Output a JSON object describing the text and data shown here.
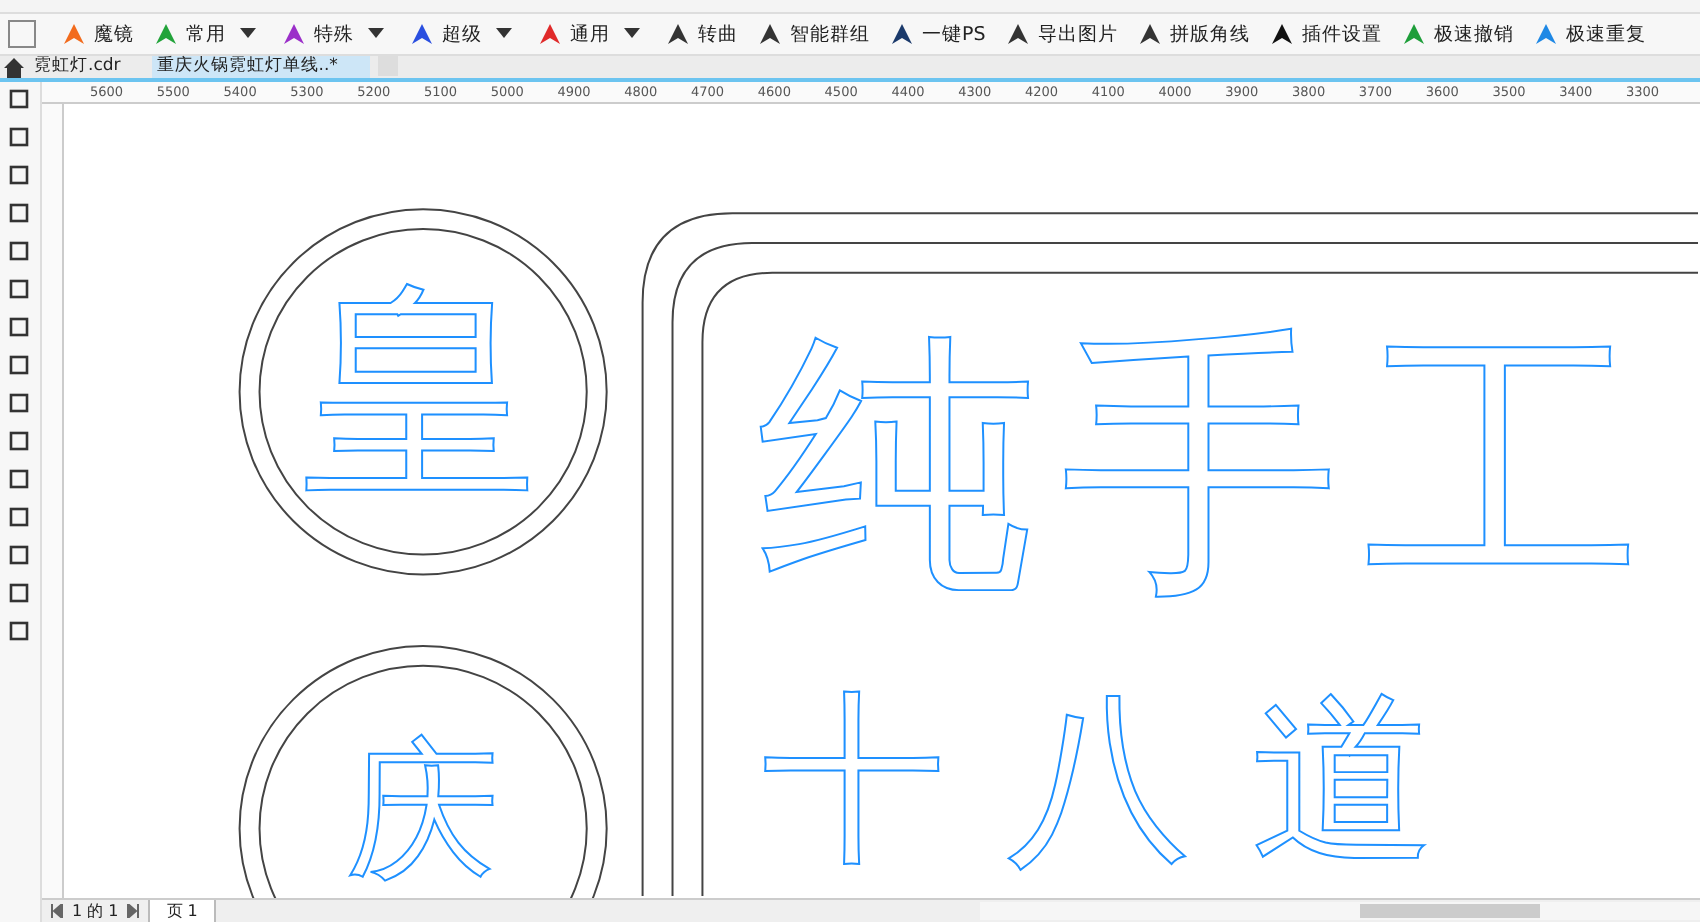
{
  "toolbar": [
    {
      "label": "魔镜",
      "dropdown": false,
      "color": "#f26b1d"
    },
    {
      "label": "常用",
      "dropdown": true,
      "color": "#22a33a"
    },
    {
      "label": "特殊",
      "dropdown": true,
      "color": "#9b2fc9"
    },
    {
      "label": "超级",
      "dropdown": true,
      "color": "#2a4fe0"
    },
    {
      "label": "通用",
      "dropdown": true,
      "color": "#e02a2a"
    },
    {
      "label": "转曲",
      "dropdown": false,
      "color": "#333333"
    },
    {
      "label": "智能群组",
      "dropdown": false,
      "color": "#333333"
    },
    {
      "label": "一键PS",
      "dropdown": false,
      "color": "#1b3a6b"
    },
    {
      "label": "导出图片",
      "dropdown": false,
      "color": "#333333"
    },
    {
      "label": "拼版角线",
      "dropdown": false,
      "color": "#333333"
    },
    {
      "label": "插件设置",
      "dropdown": false,
      "color": "#111111"
    },
    {
      "label": "极速撤销",
      "dropdown": false,
      "color": "#1e9e3a"
    },
    {
      "label": "极速重复",
      "dropdown": false,
      "color": "#1e88e5"
    }
  ],
  "tabs": [
    {
      "label": "霓虹灯.cdr",
      "selected": false
    },
    {
      "label": "重庆火锅霓虹灯单线..*",
      "selected": true
    }
  ],
  "ruler": [
    "5600",
    "5500",
    "5400",
    "5300",
    "5200",
    "5100",
    "5000",
    "4900",
    "4800",
    "4700",
    "4600",
    "4500",
    "4400",
    "4300",
    "4200",
    "4100",
    "4000",
    "3900",
    "3800",
    "3700",
    "3600",
    "3500",
    "3400",
    "3300"
  ],
  "canvas": {
    "seal_1": "皇",
    "seal_2": "庆",
    "line_1": "纯手工",
    "line_2": "十八道"
  },
  "pager": {
    "count": "1 的 1",
    "page_tab": "页 1"
  }
}
